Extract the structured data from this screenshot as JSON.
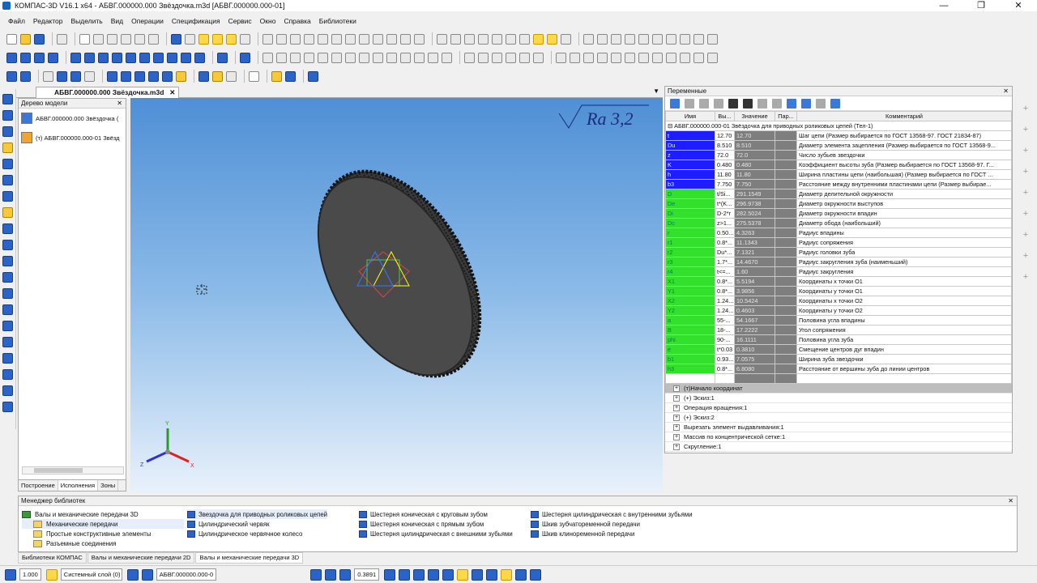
{
  "window": {
    "title": "КОМПАС-3D V16.1 x64 - АБВГ.000000.000 Звёздочка.m3d [АБВГ.000000.000-01]",
    "minimize": "—",
    "maximize": "❐",
    "close": "✕"
  },
  "menu": [
    "Файл",
    "Редактор",
    "Выделить",
    "Вид",
    "Операции",
    "Спецификация",
    "Сервис",
    "Окно",
    "Справка",
    "Библиотеки"
  ],
  "doc_tab": {
    "label": "АБВГ.000000.000 Звёздочка.m3d",
    "close": "✕"
  },
  "tree": {
    "title": "Дерево модели",
    "pin": "✕",
    "items": [
      "АБВГ.000000.000 Звёздочка (",
      "(т) АБВГ.000000.000-01 Звёзд"
    ],
    "tabs": [
      "Построение",
      "Исполнения",
      "Зоны"
    ]
  },
  "viewport": {
    "roughness": "Ra 3,2",
    "axes": {
      "x": "X",
      "y": "Y",
      "z": "Z"
    }
  },
  "variables": {
    "title": "Переменные",
    "pin": "✕",
    "headers": {
      "name": "Имя",
      "expr": "Вы...",
      "value": "Значение",
      "param": "Пар...",
      "comment": "Комментарий"
    },
    "group": "АБВГ.000000.000-01 Звёздочка для приводных роликовых цепей (Тел-1)",
    "rows": [
      {
        "name": "t",
        "expr": "12.70",
        "value": "12.70",
        "comment": "Шаг цепи (Размер выбирается по ГОСТ 13568-97. ГОСТ 21834-87)",
        "kind": "blue"
      },
      {
        "name": "Du",
        "expr": "8.510",
        "value": "8.510",
        "comment": "Диаметр элемента зацепления (Размер выбирается по ГОСТ 13568-9...",
        "kind": "blue"
      },
      {
        "name": "z",
        "expr": "72.0",
        "value": "72.0",
        "comment": "Число зубьев звездочки",
        "kind": "blue"
      },
      {
        "name": "K",
        "expr": "0.480",
        "value": "0.480",
        "comment": "Коэффициент высоты зуба (Размер выбирается по ГОСТ 13568-97. Г...",
        "kind": "blue"
      },
      {
        "name": "h",
        "expr": "11.80",
        "value": "11.80",
        "comment": "Ширина пластины цепи (наибольшая) (Размер выбирается по ГОСТ ...",
        "kind": "blue"
      },
      {
        "name": "b3",
        "expr": "7.750",
        "value": "7.750",
        "comment": "Расстояние между внутренними пластинами цепи (Размер выбирае...",
        "kind": "blue"
      },
      {
        "name": "D",
        "expr": "t/Si...",
        "value": "291.1549",
        "comment": "Диаметр делительной окружности",
        "kind": "green"
      },
      {
        "name": "De",
        "expr": "t*(K...",
        "value": "296.9738",
        "comment": "Диаметр окружности выступов",
        "kind": "green"
      },
      {
        "name": "Di",
        "expr": "D-2*r",
        "value": "282.5024",
        "comment": "Диаметр окружности впадин",
        "kind": "green"
      },
      {
        "name": "Dc",
        "expr": "z>1...",
        "value": "275.5378",
        "comment": "Диаметр обода (наибольший)",
        "kind": "green"
      },
      {
        "name": "r",
        "expr": "0.50...",
        "value": "4.3263",
        "comment": "Радиус впадины",
        "kind": "green"
      },
      {
        "name": "r1",
        "expr": "0.8*...",
        "value": "11.1343",
        "comment": "Радиус сопряжения",
        "kind": "green"
      },
      {
        "name": "r2",
        "expr": "Du*...",
        "value": "7.1321",
        "comment": "Радиус головки зуба",
        "kind": "green"
      },
      {
        "name": "r3",
        "expr": "1.7*...",
        "value": "14.4670",
        "comment": "Радиус закругления зуба (наименьший)",
        "kind": "green"
      },
      {
        "name": "r4",
        "expr": "t<=...",
        "value": "1.60",
        "comment": "Радиус закругления",
        "kind": "green"
      },
      {
        "name": "X1",
        "expr": "0.8*...",
        "value": "5.5194",
        "comment": "Координаты x точки O1",
        "kind": "green"
      },
      {
        "name": "Y1",
        "expr": "0.8*...",
        "value": "3.9856",
        "comment": "Координаты y точки O1",
        "kind": "green"
      },
      {
        "name": "X2",
        "expr": "1.24...",
        "value": "10.5424",
        "comment": "Координаты x точки O2",
        "kind": "green"
      },
      {
        "name": "Y2",
        "expr": "1.24...",
        "value": "0.4603",
        "comment": "Координаты y точки O2",
        "kind": "green"
      },
      {
        "name": "a",
        "expr": "55-...",
        "value": "54.1667",
        "comment": "Половина угла впадины",
        "kind": "green"
      },
      {
        "name": "B",
        "expr": "18-...",
        "value": "17.2222",
        "comment": "Угол сопряжения",
        "kind": "green"
      },
      {
        "name": "phi",
        "expr": "90-...",
        "value": "16.1111",
        "comment": "Половина угла зуба",
        "kind": "green"
      },
      {
        "name": "e",
        "expr": "t*0.03",
        "value": "0.3810",
        "comment": "Смещение центров дуг впадин",
        "kind": "green"
      },
      {
        "name": "b1",
        "expr": "0.93...",
        "value": "7.0575",
        "comment": "Ширина зуба звездочки",
        "kind": "green"
      },
      {
        "name": "h3",
        "expr": "0.8*...",
        "value": "6.8080",
        "comment": "Расстояние от вершины зуба до линии центров",
        "kind": "green"
      }
    ],
    "operations": [
      "(т)Начало координат",
      "(+) Эскиз:1",
      "Операция вращения:1",
      "(+) Эскиз:2",
      "Вырезать элемент выдавливания:1",
      "Массив по концентрической сетке:1",
      "Скругление:1"
    ]
  },
  "library_manager": {
    "title": "Менеджер библиотек",
    "pin": "✕",
    "root": "Валы и механические передачи 3D",
    "folders": [
      "Механические передачи",
      "Простые конструктивные элементы",
      "Разъемные соединения"
    ],
    "col1": [
      "Звездочка для приводных роликовых цепей",
      "Цилиндрический червяк",
      "Цилиндрическое червячное колесо"
    ],
    "col2": [
      "Шестерня коническая с круговым зубом",
      "Шестерня коническая с прямым зубом",
      "Шестерня цилиндрическая с внешними зубьями"
    ],
    "col3": [
      "Шестерня цилиндрическая с внутренними зубьями",
      "Шкив зубчатоременной передачи",
      "Шкив клиноременной передачи"
    ],
    "tabs": [
      "Библиотеки КОМПАС",
      "Валы и механические передачи 2D",
      "Валы и механические передачи 3D"
    ]
  },
  "status": {
    "scale": "1.000",
    "layer": "Системный слой (0)",
    "doc": "АБВГ.000000.000-0",
    "zoom": "0.3891"
  }
}
